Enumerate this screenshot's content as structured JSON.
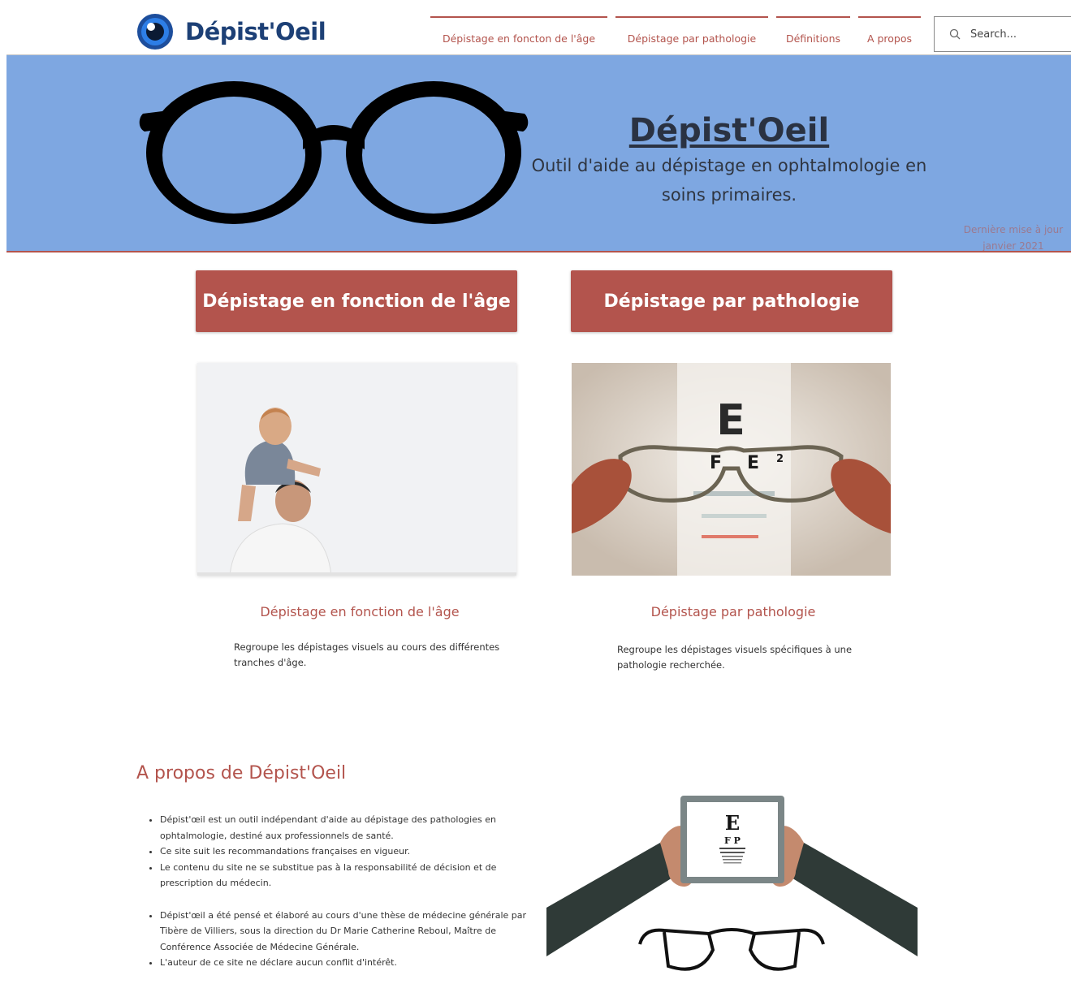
{
  "header": {
    "brand": "Dépist'Oeil",
    "nav": [
      "Dépistage en foncton de l'âge",
      "Dépistage par pathologie",
      "Définitions",
      "A propos"
    ],
    "search_placeholder": "Search..."
  },
  "hero": {
    "title": "Dépist'Oeil",
    "subtitle_line1": "Outil d'aide au dépistage en ophtalmologie en",
    "subtitle_line2": "soins primaires.",
    "update_line1": "Dernière mise à jour",
    "update_line2": "janvier 2021"
  },
  "buttons": {
    "age": "Dépistage en fonction de l'âge",
    "pathology": "Dépistage par pathologie"
  },
  "cards": {
    "age": {
      "title": "Dépistage en fonction de l'âge",
      "desc": "Regroupe les dépistages visuels au cours des différentes tranches d'âge."
    },
    "pathology": {
      "title": "Dépistage par pathologie",
      "desc": "Regroupe les dépistages visuels spécifiques à une pathologie recherchée."
    }
  },
  "about": {
    "title": "A propos de Dépist'Oeil",
    "items": [
      "Dépist'œil est un outil indépendant d'aide au dépistage des pathologies en ophtalmologie, destiné aux professionnels de santé.",
      "Ce site suit les recommandations françaises en vigueur.",
      "Le contenu du site ne se substitue pas à la responsabilité de décision et de prescription du médecin.",
      "Dépist'œil a été pensé et élaboré au cours d'une thèse de médecine générale par Tibère de Villiers, sous la direction du Dr Marie Catherine Reboul, Maître de Conférence Associée de Médecine Générale.",
      "L'auteur de ce site ne déclare aucun conflit d'intérêt."
    ],
    "chart_letters": [
      "E",
      "F P"
    ]
  },
  "colors": {
    "accent": "#b3544d",
    "hero_bg": "#7ea7e1",
    "brand_text": "#1d4076"
  }
}
